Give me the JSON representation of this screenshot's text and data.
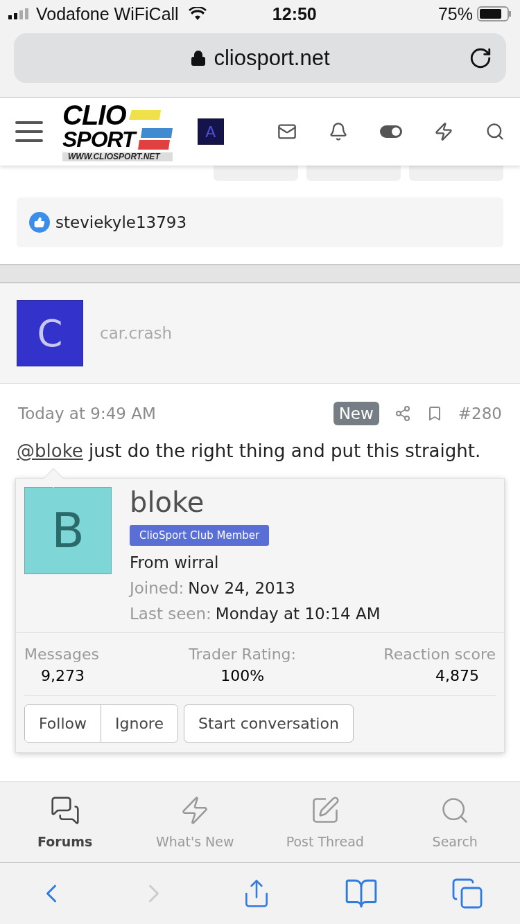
{
  "status_bar": {
    "carrier": "Vodafone WiFiCall",
    "time": "12:50",
    "battery": "75%"
  },
  "address_bar": {
    "url": "cliosport.net"
  },
  "header": {
    "logo": {
      "line_1": "CLIO",
      "line_2": "SPORT",
      "url": "WWW.CLIOSPORT.NET"
    },
    "account_initial": "A"
  },
  "reactions": {
    "user": "steviekyle13793"
  },
  "author": {
    "initial": "C",
    "name": "car.crash"
  },
  "post": {
    "time": "Today at 9:49 AM",
    "badge": "New",
    "number": "#280",
    "mention": "@bloke",
    "text": "just do the right thing and put this straight."
  },
  "member_card": {
    "initial": "B",
    "name": "bloke",
    "banner": "ClioSport Club Member",
    "location": "From wirral",
    "details": [
      {
        "label": "Joined:",
        "value": "Nov 24, 2013"
      },
      {
        "label": "Last seen:",
        "value": "Monday at 10:14 AM"
      }
    ],
    "stats": [
      {
        "label": "Messages",
        "value": "9,273"
      },
      {
        "label": "Trader Rating:",
        "value": "100%"
      },
      {
        "label": "Reaction score",
        "value": "4,875"
      }
    ],
    "buttons": [
      "Follow",
      "Ignore",
      "Start conversation"
    ]
  },
  "bottom_nav": [
    {
      "label": "Forums",
      "kind": "forums",
      "selected": true
    },
    {
      "label": "What's New",
      "kind": "new",
      "selected": false
    },
    {
      "label": "Post Thread",
      "kind": "post",
      "selected": false
    },
    {
      "label": "Search",
      "kind": "search",
      "selected": false
    }
  ],
  "browser_toolbar": {
    "back_disabled": false,
    "forward_disabled": true
  }
}
